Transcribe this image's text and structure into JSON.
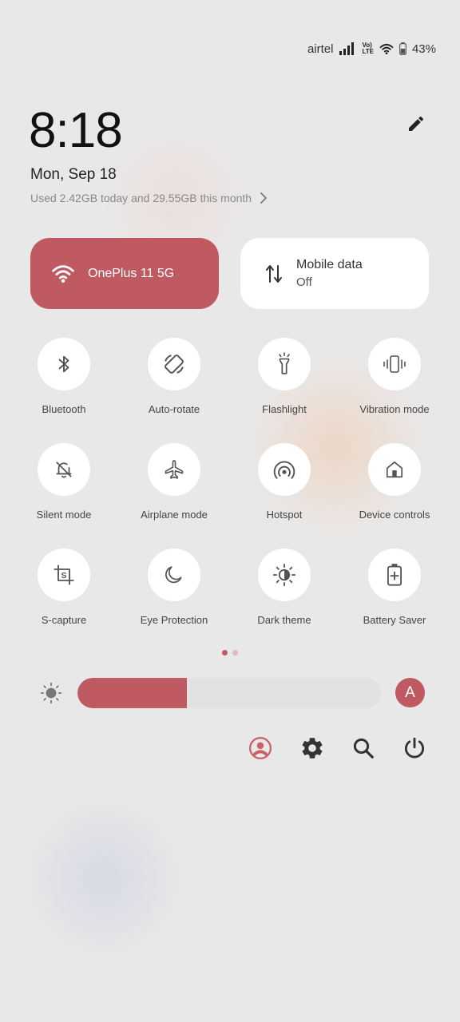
{
  "status_bar": {
    "carrier": "airtel",
    "volte_line1": "Vo)",
    "volte_line2": "LTE",
    "battery_percent": "43%",
    "icons": [
      "signal-icon",
      "volte-icon",
      "wifi-icon",
      "battery-icon"
    ]
  },
  "header": {
    "time": "8:18",
    "date": "Mon, Sep 18",
    "data_usage": "Used 2.42GB today and 29.55GB this month",
    "icons": [
      "edit-icon",
      "chevron-right-icon"
    ]
  },
  "wide_tiles": {
    "wifi": {
      "label": "OnePlus 11 5G",
      "icon": "wifi-icon",
      "active": true
    },
    "mobile_data": {
      "label": "Mobile data",
      "state": "Off",
      "icon": "data-arrows-icon",
      "active": false
    }
  },
  "tiles": [
    {
      "label": "Bluetooth",
      "icon": "bluetooth-icon"
    },
    {
      "label": "Auto-rotate",
      "icon": "auto-rotate-icon"
    },
    {
      "label": "Flashlight",
      "icon": "flashlight-icon"
    },
    {
      "label": "Vibration mode",
      "icon": "vibration-icon"
    },
    {
      "label": "Silent mode",
      "icon": "bell-off-icon"
    },
    {
      "label": "Airplane mode",
      "icon": "airplane-icon"
    },
    {
      "label": "Hotspot",
      "icon": "hotspot-icon"
    },
    {
      "label": "Device controls",
      "icon": "home-icon"
    },
    {
      "label": "S-capture",
      "icon": "scapture-icon"
    },
    {
      "label": "Eye Protection",
      "icon": "moon-icon"
    },
    {
      "label": "Dark theme",
      "icon": "dark-theme-icon"
    },
    {
      "label": "Battery Saver",
      "icon": "battery-saver-icon"
    }
  ],
  "page_indicator": {
    "current": 1,
    "total": 2
  },
  "brightness": {
    "level": 0.36,
    "auto_label": "A"
  },
  "bottom_bar": {
    "icons": [
      "user-icon",
      "settings-icon",
      "search-icon",
      "power-icon"
    ]
  },
  "colors": {
    "accent": "#bf5a62",
    "background": "#e9e8e8",
    "tile": "#ffffff",
    "icon": "#555555",
    "dot_inactive": "#e2b7ba"
  }
}
